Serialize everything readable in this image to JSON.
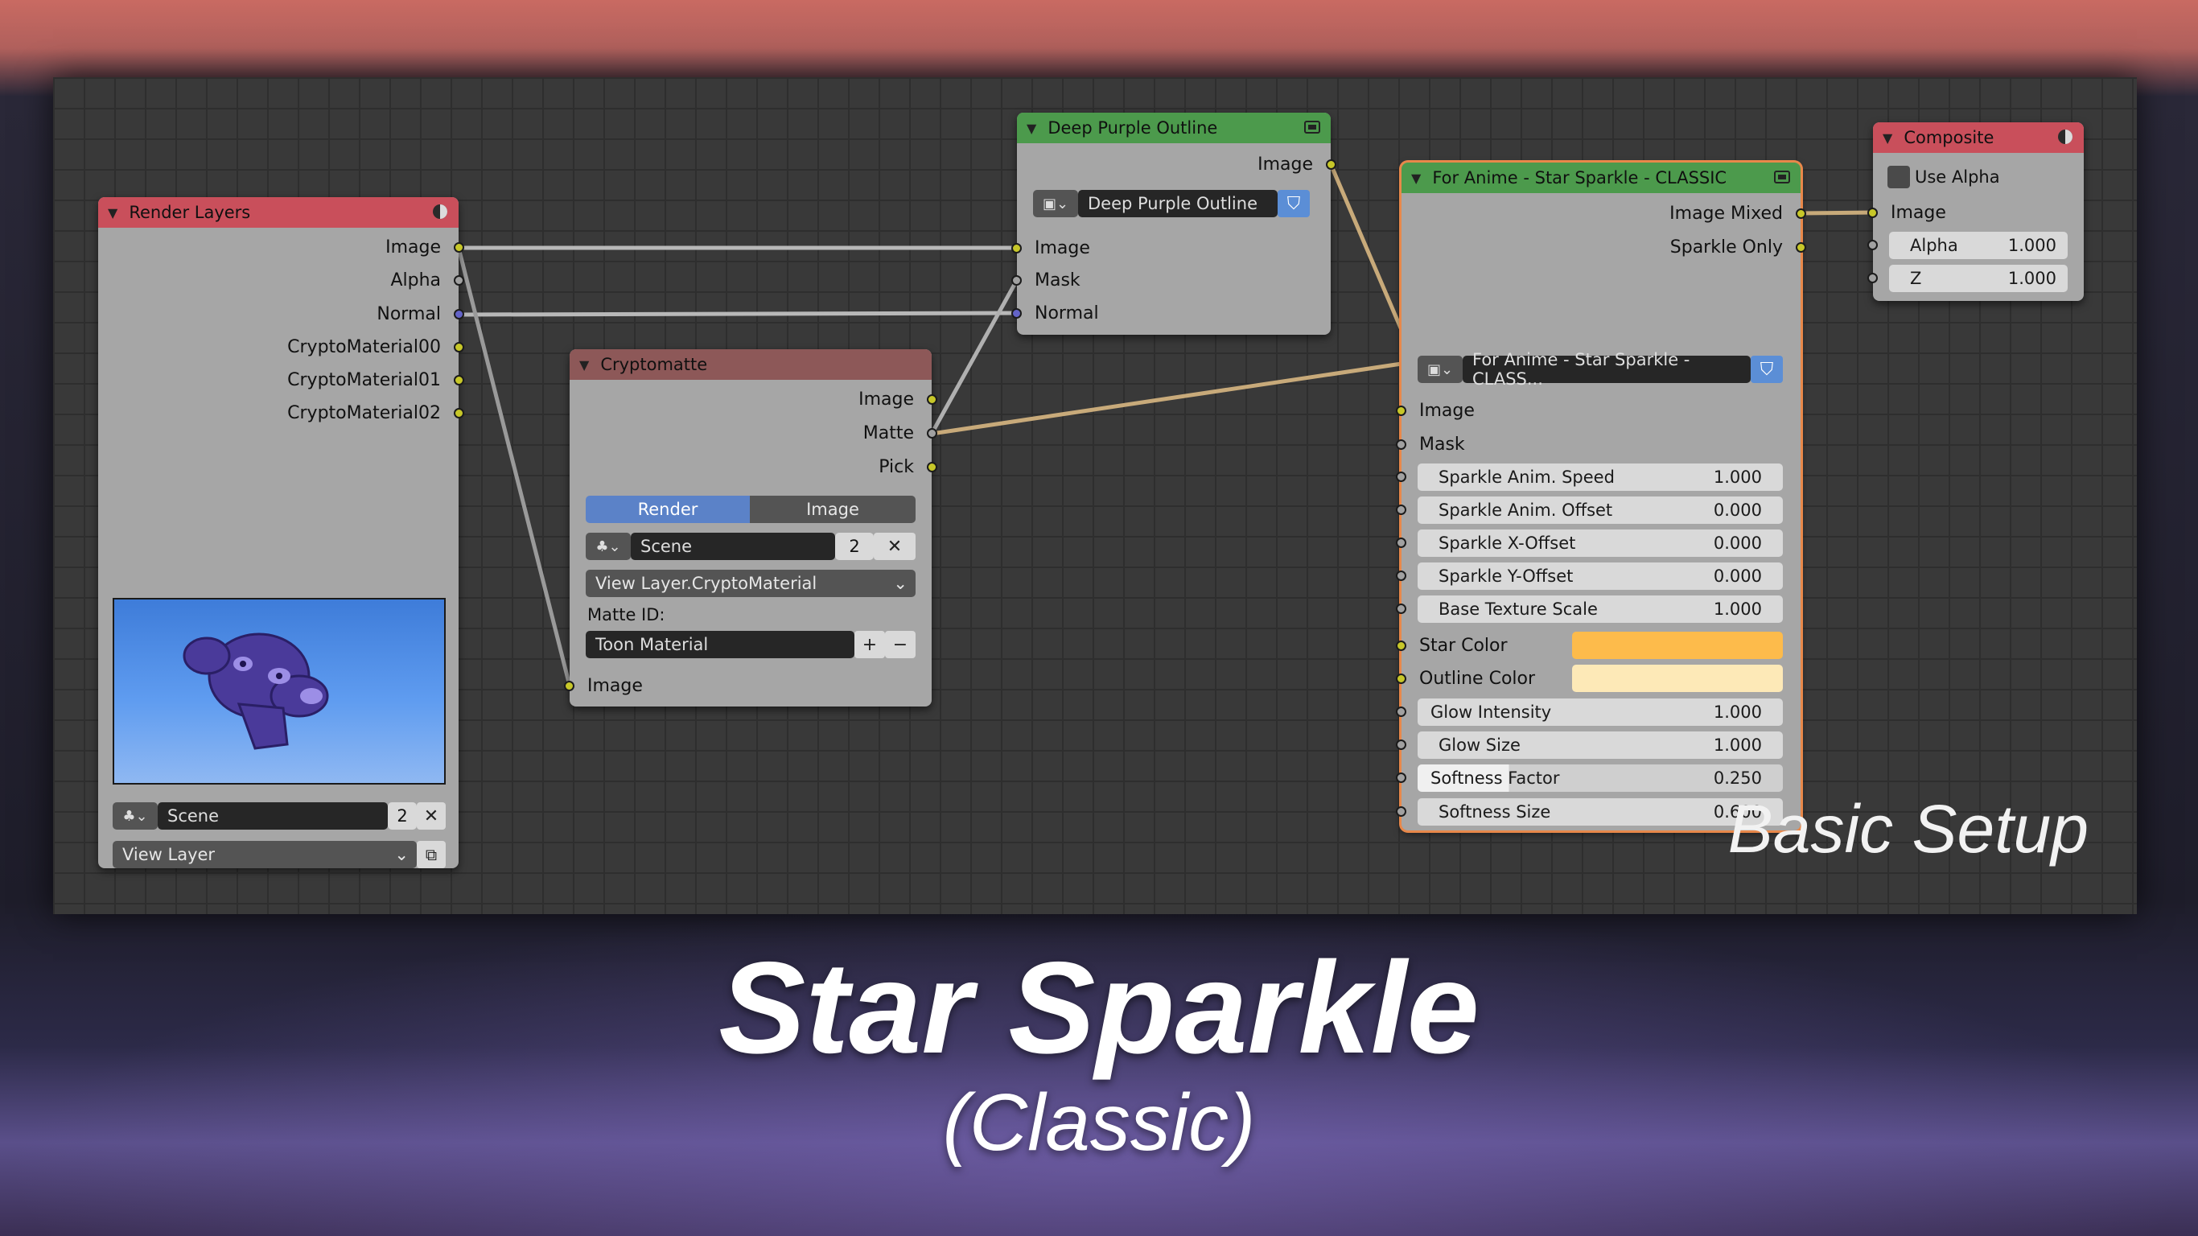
{
  "editor": {
    "caption": "Basic Setup"
  },
  "title": {
    "main": "Star Sparkle",
    "sub": "(Classic)"
  },
  "colors": {
    "render_header": "#c94f5b",
    "crypto_header": "#8d5858",
    "group_header": "#4c9a4c",
    "star_color": "#fdbb4b",
    "outline_color": "#fde9b7",
    "accent": "#5b8ed6"
  },
  "render_layers": {
    "title": "Render Layers",
    "outputs": [
      "Image",
      "Alpha",
      "Normal",
      "CryptoMaterial00",
      "CryptoMaterial01",
      "CryptoMaterial02"
    ],
    "scene_label": "Scene",
    "scene_users": "2",
    "view_layer": "View Layer"
  },
  "cryptomatte": {
    "title": "Cryptomatte",
    "outputs": [
      "Image",
      "Matte",
      "Pick"
    ],
    "tab_render": "Render",
    "tab_image": "Image",
    "scene_label": "Scene",
    "scene_users": "2",
    "layer": "View Layer.CryptoMaterial",
    "matte_id_label": "Matte ID:",
    "matte_id": "Toon Material",
    "input": "Image"
  },
  "deep_purple": {
    "title": "Deep Purple Outline",
    "output": "Image",
    "group_name": "Deep Purple Outline",
    "inputs": [
      "Image",
      "Mask",
      "Normal"
    ]
  },
  "star_sparkle": {
    "title": "For Anime - Star Sparkle - CLASSIC",
    "outputs": [
      "Image Mixed",
      "Sparkle Only"
    ],
    "group_name": "For Anime - Star Sparkle - CLASS...",
    "inputs": [
      "Image",
      "Mask"
    ],
    "params": [
      {
        "label": "Sparkle Anim. Speed",
        "value": "1.000"
      },
      {
        "label": "Sparkle Anim. Offset",
        "value": "0.000"
      },
      {
        "label": "Sparkle X-Offset",
        "value": "0.000"
      },
      {
        "label": "Sparkle Y-Offset",
        "value": "0.000"
      },
      {
        "label": "Base Texture Scale",
        "value": "1.000"
      }
    ],
    "star_color_label": "Star Color",
    "outline_color_label": "Outline Color",
    "params2": [
      {
        "label": "Glow Intensity",
        "value": "1.000"
      },
      {
        "label": "Glow Size",
        "value": "1.000"
      },
      {
        "label": "Softness Factor",
        "value": "0.250"
      },
      {
        "label": "Softness Size",
        "value": "0.600"
      }
    ]
  },
  "composite": {
    "title": "Composite",
    "use_alpha": "Use Alpha",
    "input": "Image",
    "alpha_label": "Alpha",
    "alpha_value": "1.000",
    "z_label": "Z",
    "z_value": "1.000"
  }
}
